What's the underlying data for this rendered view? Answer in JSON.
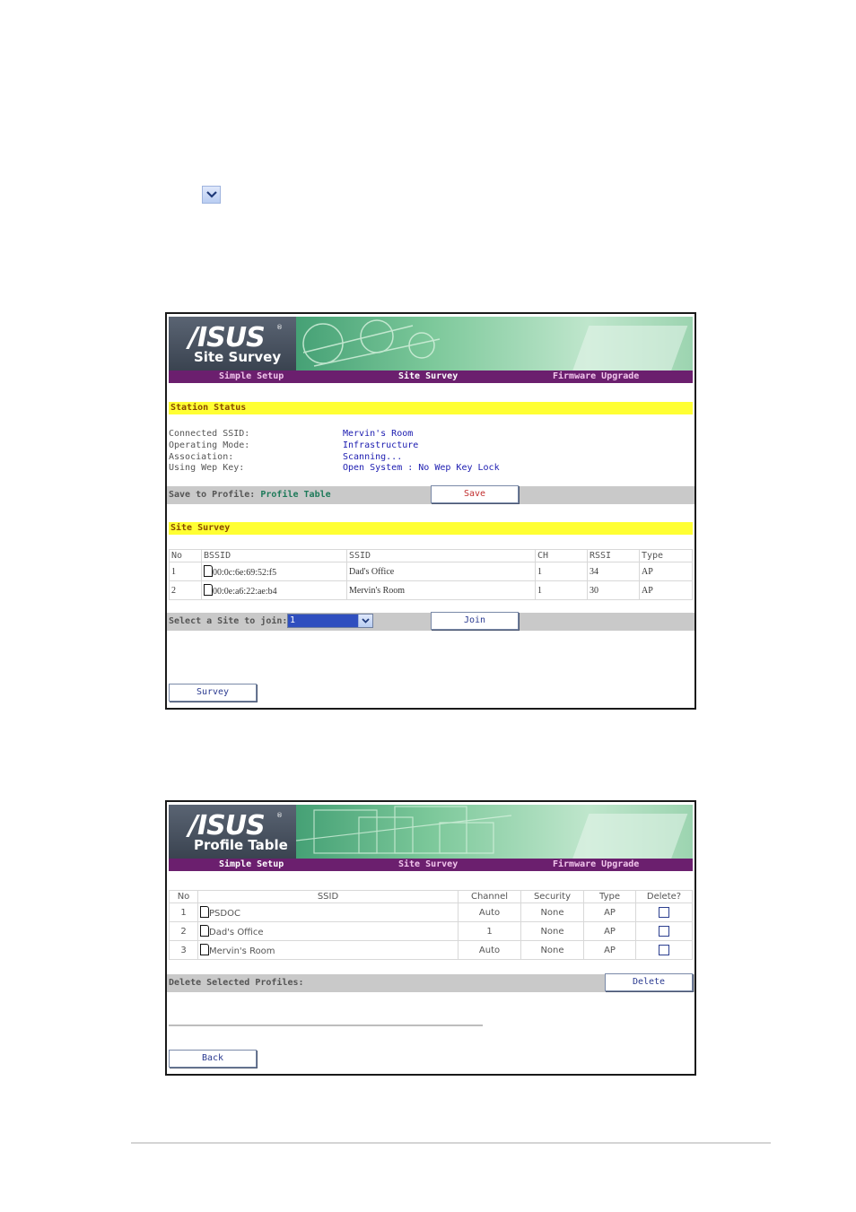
{
  "inline_dropdown": {
    "icon": "chevron-down-icon"
  },
  "nav": {
    "simple": "Simple Setup",
    "survey": "Site Survey",
    "firmware": "Firmware Upgrade"
  },
  "shot1": {
    "logo": "/ISUS",
    "logo_tm": "®",
    "page_name": "Site Survey",
    "station_status_title": "Station Status",
    "status": [
      {
        "label": "Connected SSID:",
        "value": "Mervin's Room"
      },
      {
        "label": "Operating Mode:",
        "value": "Infrastructure"
      },
      {
        "label": "Association:",
        "value": "Scanning..."
      },
      {
        "label": "Using Wep Key:",
        "value": "Open System : No Wep Key Lock"
      }
    ],
    "save_prefix": "Save to Profile: ",
    "save_link": "Profile Table",
    "save_button": "Save",
    "site_survey_title": "Site Survey",
    "table_headers": [
      "No",
      "BSSID",
      "SSID",
      "CH",
      "RSSI",
      "Type"
    ],
    "rows": [
      {
        "no": "1",
        "bssid": "00:0c:6e:69:52:f5",
        "ssid": "Dad's Office",
        "ch": "1",
        "rssi": "34",
        "type": "AP"
      },
      {
        "no": "2",
        "bssid": "00:0e:a6:22:ae:b4",
        "ssid": "Mervin's Room",
        "ch": "1",
        "rssi": "30",
        "type": "AP"
      }
    ],
    "select_label": "Select a Site to join:",
    "select_value": "1",
    "join_button": "Join",
    "survey_button": "Survey"
  },
  "shot2": {
    "logo": "/ISUS",
    "logo_tm": "®",
    "page_name": "Profile Table",
    "table_headers": [
      "No",
      "SSID",
      "Channel",
      "Security",
      "Type",
      "Delete?"
    ],
    "rows": [
      {
        "no": "1",
        "ssid": "PSDOC",
        "channel": "Auto",
        "security": "None",
        "type": "AP"
      },
      {
        "no": "2",
        "ssid": "Dad's Office",
        "channel": "1",
        "security": "None",
        "type": "AP"
      },
      {
        "no": "3",
        "ssid": "Mervin's Room",
        "channel": "Auto",
        "security": "None",
        "type": "AP"
      }
    ],
    "delete_label": "Delete Selected Profiles:",
    "delete_button": "Delete",
    "back_button": "Back"
  }
}
